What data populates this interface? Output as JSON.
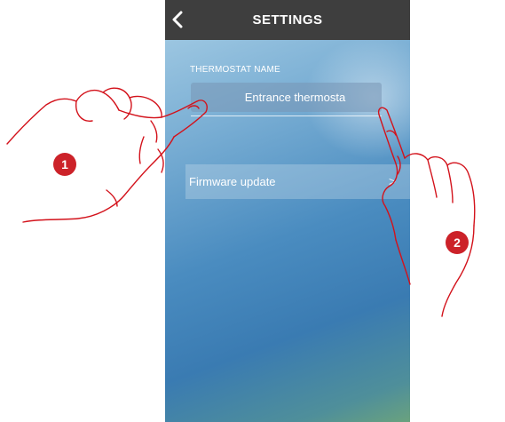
{
  "header": {
    "title": "SETTINGS",
    "back_icon": "chevron-left-icon"
  },
  "thermostat": {
    "label": "THERMOSTAT NAME",
    "value": "Entrance thermosta"
  },
  "firmware": {
    "label": "Firmware update",
    "chevron": ">"
  },
  "annotations": {
    "step1": "1",
    "step2": "2"
  },
  "colors": {
    "header_bg": "#3e3e3e",
    "accent_badge": "#cc2229",
    "hand_stroke": "#d3121b"
  }
}
